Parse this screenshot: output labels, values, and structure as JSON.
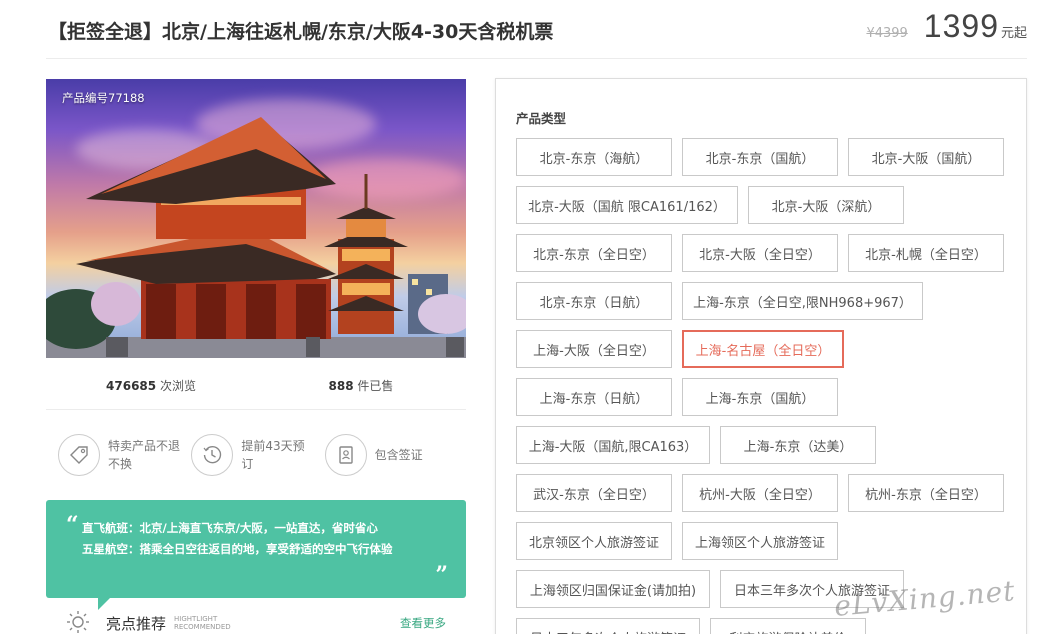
{
  "header": {
    "title": "【拒签全退】北京/上海往返札幌/东京/大阪4-30天含税机票",
    "old_price": "¥4399",
    "price": "1399",
    "price_unit": "元起"
  },
  "product": {
    "code": "产品编号77188",
    "views_count": "476685",
    "views_label": " 次浏览",
    "sold_count": "888",
    "sold_label": " 件已售"
  },
  "features": [
    {
      "icon": "tag-icon",
      "text": "特卖产品不退不换"
    },
    {
      "icon": "clock-icon",
      "text": "提前43天预订"
    },
    {
      "icon": "passport-icon",
      "text": "包含签证"
    }
  ],
  "recommend": {
    "line1": "直飞航班：北京/上海直飞东京/大阪，一站直达，省时省心",
    "line2": "五星航空：搭乘全日空往返目的地，享受舒适的空中飞行体验",
    "quote_open": "“",
    "quote_close": "”"
  },
  "highlight": {
    "title": "亮点推荐",
    "en_line1": "HIGHTLIGHT",
    "en_line2": "RECOMMENDED",
    "more": "查看更多"
  },
  "product_type": {
    "label": "产品类型",
    "selected": "上海-名古屋（全日空）",
    "options": [
      "北京-东京（海航）",
      "北京-东京（国航）",
      "北京-大阪（国航）",
      "北京-大阪（国航 限CA161/162）",
      "北京-大阪（深航）",
      "北京-东京（全日空）",
      "北京-大阪（全日空）",
      "北京-札幌（全日空）",
      "北京-东京（日航）",
      "上海-东京（全日空,限NH968+967）",
      "上海-大阪（全日空）",
      "上海-名古屋（全日空）",
      "上海-东京（日航）",
      "上海-东京（国航）",
      "上海-大阪（国航,限CA163）",
      "上海-东京（达美）",
      "武汉-东京（全日空）",
      "杭州-大阪（全日空）",
      "杭州-东京（全日空）",
      "北京领区个人旅游签证",
      "上海领区个人旅游签证",
      "上海领区归国保证金(请加拍)",
      "日本三年多次个人旅游签证",
      "日本五年多次个人旅游签证",
      "利宁旅游保险补差价"
    ]
  },
  "watermark": "eLvXing.net",
  "colors": {
    "accent_green": "#4fc2a3",
    "selected_red": "#e56b5a",
    "more_link": "#3aa882"
  }
}
